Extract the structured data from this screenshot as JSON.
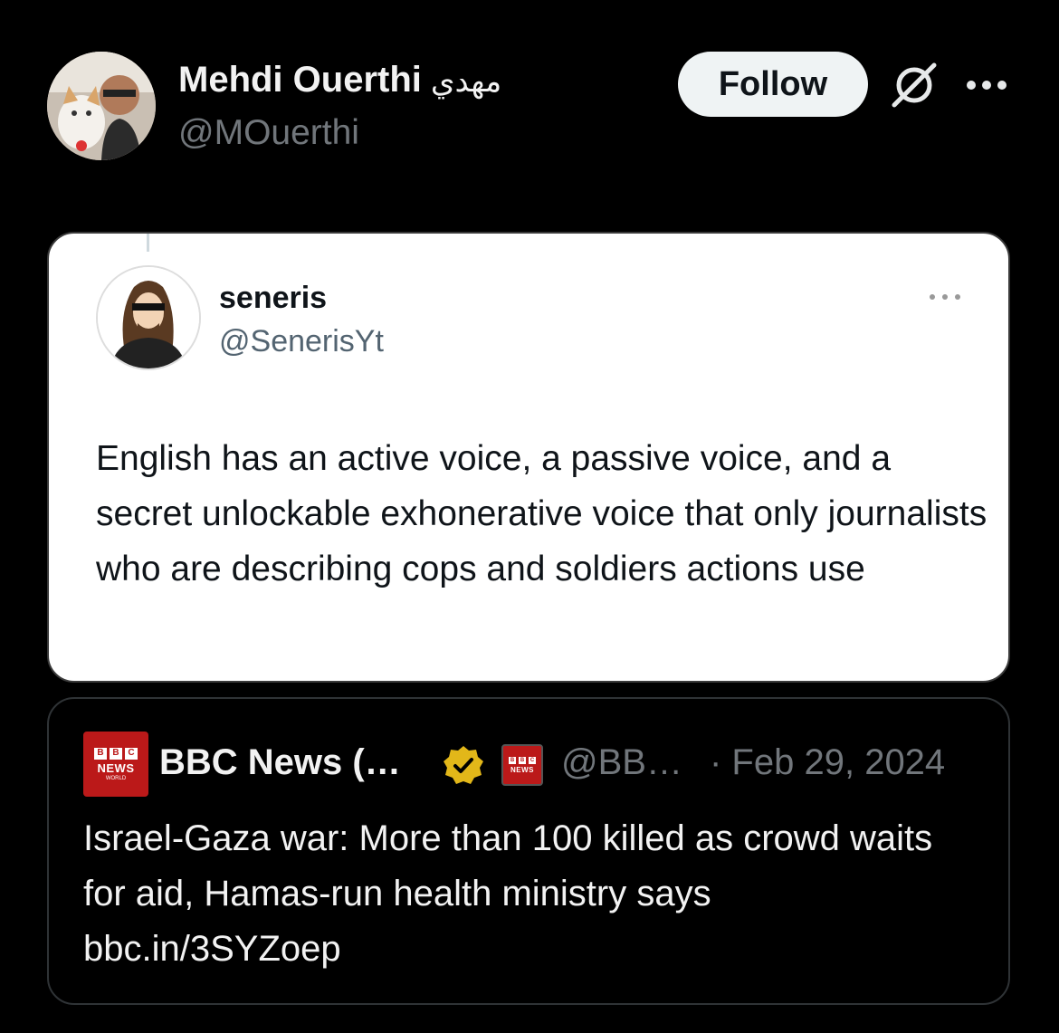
{
  "author": {
    "display_name": "Mehdi Ouerthi",
    "display_name_arabic": "مهدي",
    "handle": "@MOuerthi",
    "avatar_icon": "avatar-photo"
  },
  "actions": {
    "follow_label": "Follow",
    "grok_icon": "grok-icon",
    "more_icon": "more-icon"
  },
  "embedded_image": {
    "name": "seneris",
    "handle": "@SenerisYt",
    "text": "English has an active voice, a passive voice, and a secret unlockable exhonerative voice that only journalists who are describing cops and soldiers actions use"
  },
  "quoted_tweet": {
    "name": "BBC News (…",
    "handle": "@BB…",
    "date": "· Feb 29, 2024",
    "text": "Israel-Gaza war: More than 100 killed as crowd waits for aid, Hamas-run health ministry says",
    "link": "bbc.in/3SYZoep",
    "logo_letters": [
      "B",
      "B",
      "C"
    ],
    "logo_news": "NEWS",
    "logo_sub": "WORLD",
    "verified_color": "#e2b719",
    "brand_color": "#bb1919"
  }
}
